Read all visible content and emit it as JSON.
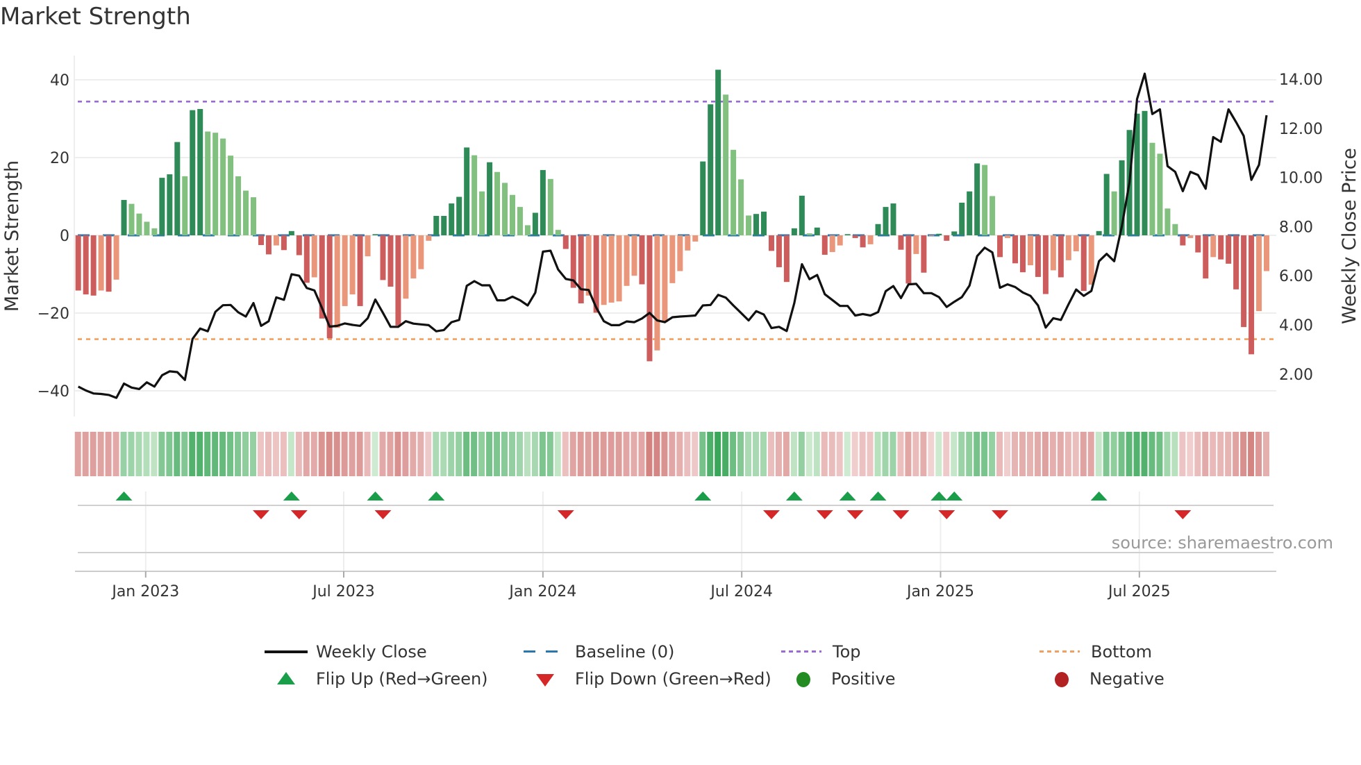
{
  "title": "Market Strength",
  "source": "source: sharemaestro.com",
  "colors": {
    "pos_strong": "#2e8b57",
    "pos_weak": "#82c07f",
    "neg_strong": "#cd5c5c",
    "neg_weak": "#e9967a",
    "baseline": "#2a77b0",
    "top": "#9b6ad6",
    "bottom": "#f0a060",
    "flip_up": "#1a9e4a",
    "flip_down": "#d62728",
    "positive": "#228b22",
    "negative": "#b22222",
    "close": "#111111"
  },
  "chart_data": {
    "type": "bar",
    "title": "Market Strength",
    "ylabel": "Market Strength",
    "y2label": "Weekly Close Price",
    "ylim": [
      -46,
      46
    ],
    "y2lim": [
      0.35,
      16.6
    ],
    "yticks": [
      "40",
      "20",
      "0",
      "−20",
      "−40"
    ],
    "ytick_values": [
      40,
      20,
      0,
      -20,
      -40
    ],
    "y2ticks": [
      "14.00",
      "12.00",
      "10.00",
      "8.00",
      "6.00",
      "4.00",
      "2.00"
    ],
    "y2tick_values": [
      14,
      12,
      10,
      8,
      6,
      4,
      2
    ],
    "xticks": [
      {
        "label": "Jan 2023",
        "week": 8.85
      },
      {
        "label": "Jul 2023",
        "week": 34.85
      },
      {
        "label": "Jan 2024",
        "week": 61.0
      },
      {
        "label": "Jul 2024",
        "week": 87.1
      },
      {
        "label": "Jan 2025",
        "week": 113.2
      },
      {
        "label": "Jul 2025",
        "week": 139.3
      }
    ],
    "top_level": 34.4,
    "bottom_level": -26.7,
    "baseline": 0,
    "strength": [
      -14.2,
      -15.2,
      -15.5,
      -14.2,
      -14.5,
      -11.4,
      9.1,
      8.1,
      5.6,
      3.5,
      1.8,
      14.8,
      15.7,
      24.0,
      15.2,
      32.2,
      32.5,
      26.7,
      26.4,
      24.9,
      20.5,
      15.2,
      11.5,
      9.8,
      -2.5,
      -4.9,
      -2.6,
      -3.8,
      1.1,
      -5.1,
      -12.2,
      -10.8,
      -21.4,
      -26.5,
      -23.8,
      -18.2,
      -15.2,
      -18.2,
      -5.4,
      0.3,
      -11.5,
      -13.2,
      -23.2,
      -16.3,
      -11.1,
      -8.7,
      -1.4,
      5.0,
      5.0,
      8.2,
      9.9,
      22.6,
      20.6,
      11.3,
      18.8,
      16.3,
      13.5,
      10.4,
      7.3,
      2.6,
      5.8,
      16.8,
      14.5,
      1.4,
      -3.5,
      -13.5,
      -17.5,
      -15.5,
      -19.9,
      -17.9,
      -17.3,
      -17.0,
      -13.0,
      -10.4,
      -12.6,
      -32.4,
      -29.6,
      -22.3,
      -12.3,
      -9.2,
      -3.9,
      -1.6,
      19.0,
      33.7,
      42.6,
      36.2,
      22.0,
      14.4,
      5.1,
      5.5,
      6.1,
      -4.0,
      -8.2,
      -12.0,
      1.8,
      10.2,
      0.5,
      2.0,
      -5.0,
      -4.3,
      -2.6,
      0.3,
      -0.7,
      -3.1,
      -2.3,
      2.9,
      7.3,
      8.2,
      -3.7,
      -12.4,
      -4.8,
      -9.6,
      -0.2,
      0.4,
      -1.4,
      1.0,
      8.4,
      11.3,
      18.5,
      18.1,
      10.1,
      -5.6,
      -0.7,
      -7.2,
      -9.5,
      -7.7,
      -10.7,
      -15.1,
      -9.0,
      -10.8,
      -6.4,
      -4.1,
      -14.3,
      -12.7,
      1.1,
      15.8,
      11.3,
      19.3,
      27.1,
      31.3,
      32.0,
      23.8,
      21.0,
      6.9,
      2.9,
      -2.6,
      -0.7,
      -4.4,
      -11.1,
      -5.6,
      -6.2,
      -7.3,
      -13.9,
      -23.6,
      -30.6,
      -19.5,
      -9.2
    ],
    "weekly_close": [
      1.49,
      1.33,
      1.21,
      1.19,
      1.15,
      1.03,
      1.61,
      1.45,
      1.39,
      1.66,
      1.49,
      1.95,
      2.11,
      2.08,
      1.76,
      3.43,
      3.85,
      3.74,
      4.53,
      4.8,
      4.81,
      4.51,
      4.34,
      4.89,
      3.96,
      4.15,
      5.12,
      5.02,
      6.06,
      6.0,
      5.5,
      5.4,
      4.69,
      3.93,
      3.96,
      4.06,
      4.0,
      3.96,
      4.27,
      5.03,
      4.49,
      3.92,
      3.92,
      4.15,
      4.05,
      4.02,
      3.99,
      3.74,
      3.79,
      4.11,
      4.2,
      5.59,
      5.78,
      5.61,
      5.61,
      5.0,
      5.0,
      5.15,
      5.0,
      4.79,
      5.31,
      6.98,
      7.02,
      6.25,
      5.87,
      5.81,
      5.45,
      5.42,
      4.7,
      4.15,
      3.99,
      3.99,
      4.14,
      4.11,
      4.26,
      4.49,
      4.18,
      4.11,
      4.31,
      4.34,
      4.36,
      4.38,
      4.79,
      4.81,
      5.22,
      5.11,
      4.79,
      4.49,
      4.18,
      4.56,
      4.42,
      3.87,
      3.92,
      3.75,
      4.89,
      6.47,
      5.86,
      6.03,
      5.25,
      5.01,
      4.77,
      4.77,
      4.38,
      4.44,
      4.38,
      4.52,
      5.37,
      5.58,
      5.09,
      5.65,
      5.67,
      5.29,
      5.29,
      5.13,
      4.73,
      4.94,
      5.13,
      5.6,
      6.8,
      7.14,
      6.95,
      5.51,
      5.65,
      5.54,
      5.32,
      5.18,
      4.79,
      3.89,
      4.27,
      4.2,
      4.84,
      5.44,
      5.18,
      5.38,
      6.59,
      6.89,
      6.59,
      8.01,
      9.8,
      13.19,
      14.22,
      12.58,
      12.77,
      10.46,
      10.23,
      9.44,
      10.23,
      10.1,
      9.54,
      11.64,
      11.45,
      12.77,
      12.25,
      11.69,
      9.9,
      10.51,
      12.53
    ],
    "flip_up_weeks": [
      6,
      28,
      39,
      47,
      82,
      94,
      101,
      105,
      113,
      115,
      134
    ],
    "flip_down_weeks": [
      24,
      29,
      40,
      64,
      91,
      98,
      102,
      108,
      114,
      121,
      145
    ],
    "legend": [
      {
        "label": "Weekly Close"
      },
      {
        "label": "Baseline (0)"
      },
      {
        "label": "Top"
      },
      {
        "label": "Bottom"
      },
      {
        "label": "Flip Up (Red→Green)"
      },
      {
        "label": "Flip Down (Green→Red)"
      },
      {
        "label": "Positive"
      },
      {
        "label": "Negative"
      }
    ],
    "legend_placement": "bottom"
  }
}
